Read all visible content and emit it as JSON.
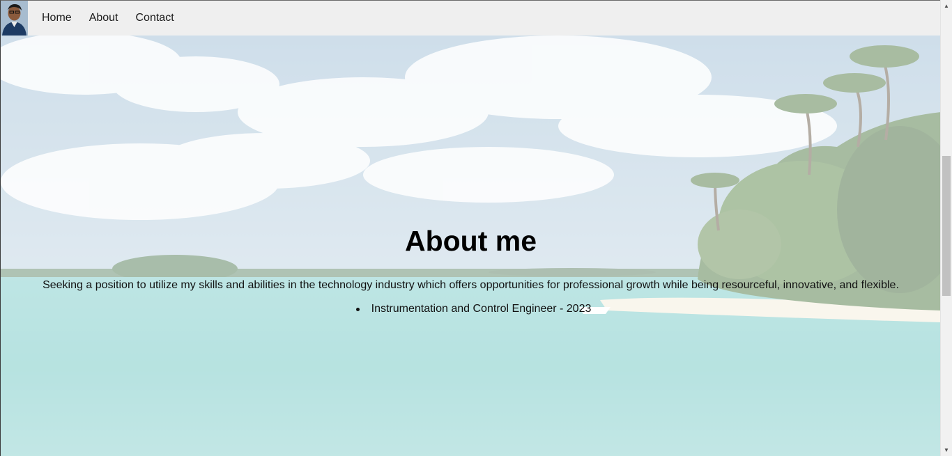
{
  "navbar": {
    "links": [
      "Home",
      "About",
      "Contact"
    ]
  },
  "about": {
    "title": "About me",
    "summary": "Seeking a position to utilize my skills and abilities in the technology industry which offers opportunities for professional growth while being resourceful, innovative, and flexible.",
    "education": [
      "Instrumentation and Control Engineer - 2023"
    ]
  },
  "colors": {
    "navbar_bg": "#efefef",
    "text": "#000000"
  }
}
